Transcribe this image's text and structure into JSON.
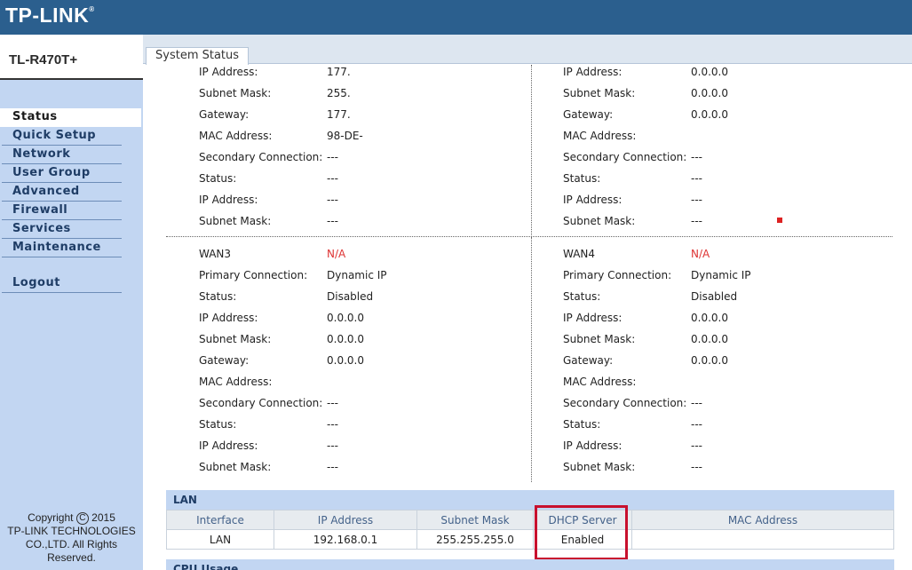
{
  "brand": {
    "logo": "TP-LINK",
    "mark": "®"
  },
  "sidebar": {
    "model": "TL-R470T+",
    "items": [
      {
        "label": "Status",
        "active": true
      },
      {
        "label": "Quick Setup"
      },
      {
        "label": "Network"
      },
      {
        "label": "User Group"
      },
      {
        "label": "Advanced"
      },
      {
        "label": "Firewall"
      },
      {
        "label": "Services"
      },
      {
        "label": "Maintenance"
      }
    ],
    "logout": "Logout",
    "copyright": {
      "line1": "Copyright",
      "symbol": "C",
      "year": "2015",
      "line2": "TP-LINK TECHNOLOGIES",
      "line3": "CO.,LTD. All Rights",
      "line4": "Reserved."
    }
  },
  "tab": {
    "label": "System Status"
  },
  "wan_top_left": [
    {
      "label": "IP Address:",
      "value": "177."
    },
    {
      "label": "Subnet Mask:",
      "value": "255."
    },
    {
      "label": "Gateway:",
      "value": "177."
    },
    {
      "label": "MAC Address:",
      "value": "98-DE-"
    },
    {
      "label": "Secondary Connection:",
      "value": "---"
    },
    {
      "label": "Status:",
      "value": "---"
    },
    {
      "label": "IP Address:",
      "value": "---"
    },
    {
      "label": "Subnet Mask:",
      "value": "---"
    }
  ],
  "wan_top_right": [
    {
      "label": "IP Address:",
      "value": "0.0.0.0"
    },
    {
      "label": "Subnet Mask:",
      "value": "0.0.0.0"
    },
    {
      "label": "Gateway:",
      "value": "0.0.0.0"
    },
    {
      "label": "MAC Address:",
      "value": ""
    },
    {
      "label": "Secondary Connection:",
      "value": "---"
    },
    {
      "label": "Status:",
      "value": "---"
    },
    {
      "label": "IP Address:",
      "value": "---"
    },
    {
      "label": "Subnet Mask:",
      "value": "---"
    }
  ],
  "wan3": {
    "name": "WAN3",
    "state": "N/A",
    "rows": [
      {
        "label": "Primary Connection:",
        "value": "Dynamic IP"
      },
      {
        "label": "Status:",
        "value": "Disabled"
      },
      {
        "label": "IP Address:",
        "value": "0.0.0.0"
      },
      {
        "label": "Subnet Mask:",
        "value": "0.0.0.0"
      },
      {
        "label": "Gateway:",
        "value": "0.0.0.0"
      },
      {
        "label": "MAC Address:",
        "value": ""
      },
      {
        "label": "Secondary Connection:",
        "value": "---"
      },
      {
        "label": "Status:",
        "value": "---"
      },
      {
        "label": "IP Address:",
        "value": "---"
      },
      {
        "label": "Subnet Mask:",
        "value": "---"
      }
    ]
  },
  "wan4": {
    "name": "WAN4",
    "state": "N/A",
    "rows": [
      {
        "label": "Primary Connection:",
        "value": "Dynamic IP"
      },
      {
        "label": "Status:",
        "value": "Disabled"
      },
      {
        "label": "IP Address:",
        "value": "0.0.0.0"
      },
      {
        "label": "Subnet Mask:",
        "value": "0.0.0.0"
      },
      {
        "label": "Gateway:",
        "value": "0.0.0.0"
      },
      {
        "label": "MAC Address:",
        "value": ""
      },
      {
        "label": "Secondary Connection:",
        "value": "---"
      },
      {
        "label": "Status:",
        "value": "---"
      },
      {
        "label": "IP Address:",
        "value": "---"
      },
      {
        "label": "Subnet Mask:",
        "value": "---"
      }
    ]
  },
  "lan": {
    "title": "LAN",
    "columns": [
      "Interface",
      "IP Address",
      "Subnet Mask",
      "DHCP Server",
      "MAC Address"
    ],
    "row": [
      "LAN",
      "192.168.0.1",
      "255.255.255.0",
      "Enabled",
      ""
    ]
  },
  "cpu": {
    "title": "CPU Usage"
  },
  "colors": {
    "accent": "#2b5f8e",
    "sidebar": "#c2d6f2",
    "highlight": "#c8102e",
    "na": "#dd3333"
  }
}
